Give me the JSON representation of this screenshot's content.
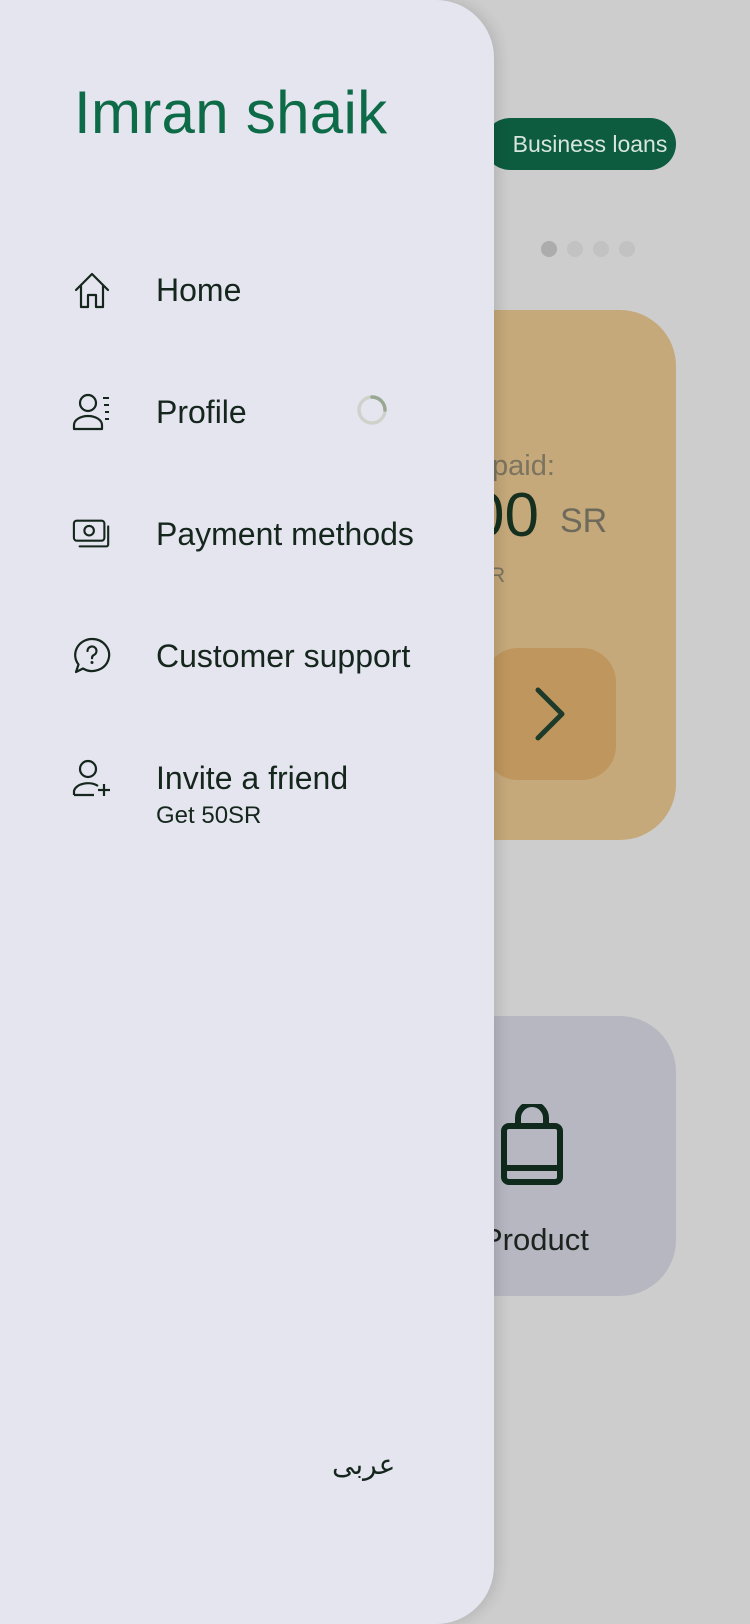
{
  "background": {
    "pill_label": "Business loans",
    "carousel": {
      "pages": 4,
      "active": 1
    },
    "loan_card": {
      "paid_label": "paid:",
      "amount": "00",
      "currency": "SR",
      "sub_value": "R",
      "bg_color": "#c5a97a"
    },
    "product_card": {
      "label": "Product",
      "icon": "shopping-bag-icon"
    }
  },
  "drawer": {
    "user_name": "Imran shaik",
    "menu": [
      {
        "icon": "home-icon",
        "label": "Home"
      },
      {
        "icon": "profile-icon",
        "label": "Profile",
        "loading": true
      },
      {
        "icon": "payment-icon",
        "label": "Payment methods"
      },
      {
        "icon": "help-icon",
        "label": "Customer support"
      },
      {
        "icon": "invite-icon",
        "label": "Invite a friend",
        "sublabel": "Get 50SR"
      }
    ],
    "language_toggle": "عربى"
  },
  "colors": {
    "brand_green": "#0e6b48",
    "drawer_bg": "#e5e5f0",
    "text_dark": "#15261c"
  }
}
